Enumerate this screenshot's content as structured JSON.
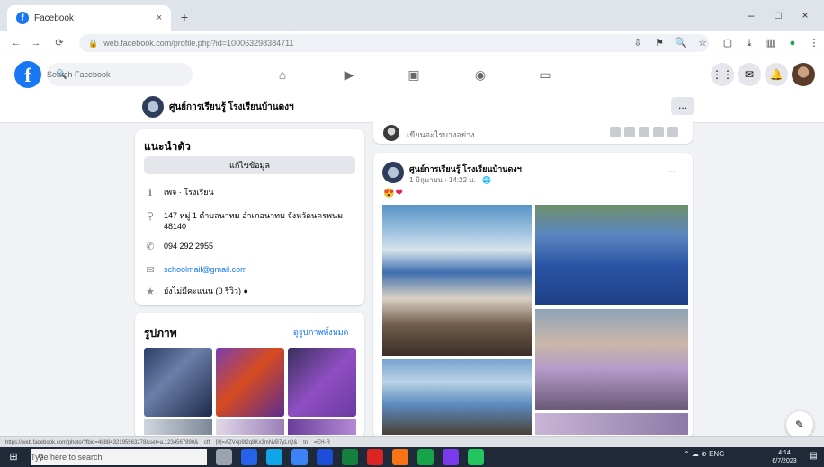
{
  "browser": {
    "tab_title": "Facebook",
    "tab_close": "×",
    "new_tab": "+",
    "window_controls": [
      "–",
      "□",
      "×"
    ],
    "nav": [
      "←",
      "→",
      "⟳"
    ],
    "url": "web.facebook.com/profile.php?id=100063298384711",
    "omnibox_icons": [
      "⇩",
      "⚑",
      "🔍",
      "☆"
    ],
    "extension_icons": [
      "▢",
      "⤓",
      "▥",
      "●",
      "⋮"
    ]
  },
  "facebook_nav": {
    "logo": "f",
    "search_placeholder": "Search Facebook",
    "center_icons": [
      "⌂",
      "▶",
      "▣",
      "◉",
      "▭"
    ],
    "right_icons": [
      "⋮⋮",
      "✉",
      "🔔"
    ]
  },
  "page_header": {
    "name": "ศูนย์การเรียนรู้ โรงเรียนบ้านดงฯ",
    "more": "..."
  },
  "intro": {
    "title": "แนะนำตัว",
    "edit_button": "แก้ไขข้อมูล",
    "rows": [
      {
        "icon": "ℹ",
        "text": "เพจ · โรงเรียน"
      },
      {
        "icon": "⚲",
        "text": "147 หมู่ 1 ตำบลนาทม อำเภอนาทม จังหวัดนครพนม 48140"
      },
      {
        "icon": "✆",
        "text": "094 292 2955"
      },
      {
        "icon": "✉",
        "text": "schoolmail@gmail.com"
      },
      {
        "icon": "★",
        "text": "ยังไม่มีคะแนน (0 รีวิว) ●"
      }
    ]
  },
  "photos": {
    "title": "รูปภาพ",
    "see_all": "ดูรูปภาพทั้งหมด"
  },
  "composer": {
    "placeholder": "เขียนอะไรบางอย่าง..."
  },
  "post": {
    "author": "ศูนย์การเรียนรู้ โรงเรียนบ้านดงฯ",
    "meta": "1 มิถุนายน · 14:22 น. · 🌐",
    "more": "...",
    "text": "😍❤"
  },
  "chat_button": "✎",
  "status_url": "https://web.facebook.com/photo/?fbid=4888432195563278&set=a.1234567890&__cft__[0]=AZV4p9t2q8Kx3mNvB7yLrQ&__tn__=EH-R",
  "taskbar": {
    "start": "⊞",
    "search_placeholder": "Type here to search",
    "tray_text": "⌃ ☁ ⊕ ENG",
    "time": "4:14",
    "date": "6/7/2023",
    "notifications": "▤"
  },
  "colors": {
    "facebook_blue": "#1877f2",
    "taskbar": "#1f2937"
  }
}
